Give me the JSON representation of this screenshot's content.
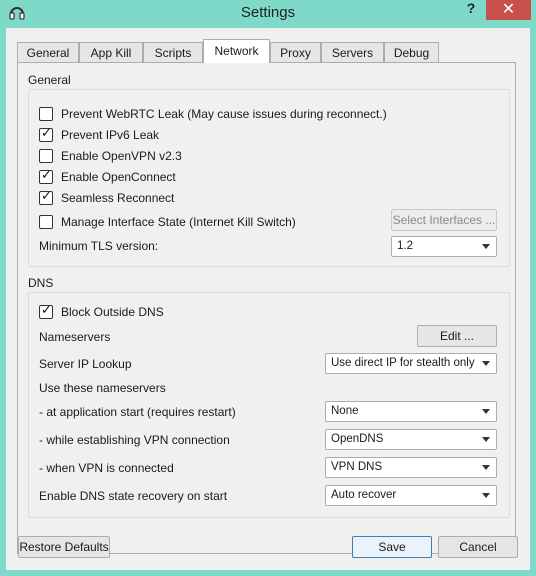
{
  "window": {
    "title": "Settings",
    "help": "?",
    "close": "✕"
  },
  "tabs": [
    "General",
    "App Kill",
    "Scripts",
    "Network",
    "Proxy",
    "Servers",
    "Debug"
  ],
  "active_tab": "Network",
  "general": {
    "label": "General",
    "options": [
      {
        "label": "Prevent WebRTC Leak (May cause issues during reconnect.)",
        "checked": false
      },
      {
        "label": "Prevent IPv6 Leak",
        "checked": true
      },
      {
        "label": "Enable OpenVPN v2.3",
        "checked": false
      },
      {
        "label": "Enable OpenConnect",
        "checked": true
      },
      {
        "label": "Seamless Reconnect",
        "checked": true
      },
      {
        "label": "Manage Interface State (Internet Kill Switch)",
        "checked": false
      }
    ],
    "select_interfaces_label": "Select Interfaces ...",
    "min_tls_label": "Minimum TLS version:",
    "min_tls_value": "1.2"
  },
  "dns": {
    "label": "DNS",
    "block_outside": {
      "label": "Block Outside DNS",
      "checked": true
    },
    "nameservers_label": "Nameservers",
    "edit_label": "Edit ...",
    "server_ip_lookup_label": "Server IP Lookup",
    "server_ip_lookup_value": "Use direct IP for stealth only",
    "use_these_label": "Use these nameservers",
    "app_start_label": " - at application start (requires restart)",
    "app_start_value": "None",
    "establishing_label": " - while establishing VPN connection",
    "establishing_value": "OpenDNS",
    "connected_label": " - when VPN is connected",
    "connected_value": "VPN DNS",
    "recovery_label": "Enable DNS state recovery on start",
    "recovery_value": "Auto recover"
  },
  "footer": {
    "restore_label": "Restore Defaults",
    "save_label": "Save",
    "cancel_label": "Cancel"
  }
}
